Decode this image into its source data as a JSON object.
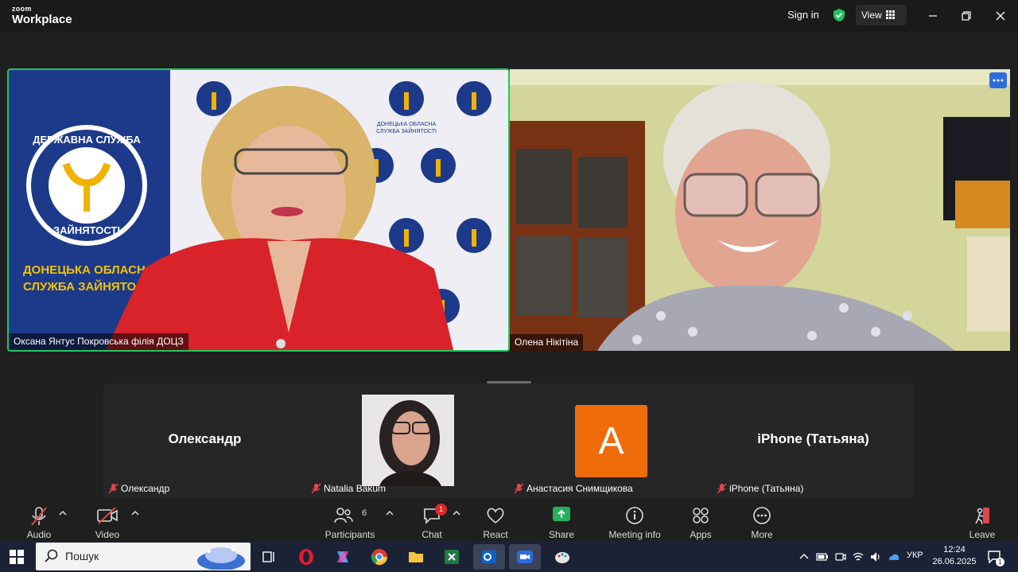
{
  "titlebar": {
    "logo_top": "zoom",
    "logo_bottom": "Workplace",
    "signin_label": "Sign in",
    "view_label": "View"
  },
  "speakers": [
    {
      "name": "Оксана Янтус Покровська філія ДОЦЗ"
    },
    {
      "name": "Олена Нікітіна"
    }
  ],
  "backdrop": {
    "emblem_top": "ДЕРЖАВНА СЛУЖБА",
    "emblem_bottom": "ЗАЙНЯТОСТІ",
    "banner_line1": "ДОНЕЦЬКА ОБЛАСНА",
    "banner_line2": "СЛУЖБА ЗАЙНЯТОСТІ",
    "small_line1": "ДОНЕЦЬКА ОБЛАСНА",
    "small_line2": "СЛУЖБА ЗАЙНЯТОСТІ"
  },
  "gallery": [
    {
      "display": "Олександр",
      "label": "Олександр",
      "muted": true
    },
    {
      "display": "",
      "label": "Natalia Bakum",
      "muted": true
    },
    {
      "display": "A",
      "label": "Анастасия Снимщикова",
      "muted": true
    },
    {
      "display": "iPhone (Татьяна)",
      "label": "iPhone (Татьяна)",
      "muted": true
    }
  ],
  "toolbar": {
    "audio": "Audio",
    "video": "Video",
    "participants": "Participants",
    "participants_count": "6",
    "chat": "Chat",
    "chat_badge": "1",
    "react": "React",
    "share": "Share",
    "meeting_info": "Meeting info",
    "apps": "Apps",
    "more": "More",
    "leave": "Leave"
  },
  "taskbar": {
    "search_placeholder": "Пошук",
    "language": "УКР",
    "time": "12:24",
    "date": "26.06.2025",
    "notification_count": "1"
  },
  "colors": {
    "active_speaker_border": "#22c55e",
    "share_green": "#23b15a",
    "avatar_orange": "#ef6c0a",
    "badge_red": "#e02828",
    "leave_red": "#e04848",
    "taskbar_bg": "#1b2236"
  },
  "icons": [
    "shield-check-icon",
    "grid-icon",
    "minimize-icon",
    "restore-icon",
    "close-icon",
    "mic-muted-icon",
    "video-off-icon",
    "participants-icon",
    "chat-icon",
    "heart-icon",
    "share-arrow-icon",
    "info-icon",
    "apps-icon",
    "more-dots-icon",
    "leave-icon",
    "windows-start-icon",
    "search-icon"
  ]
}
